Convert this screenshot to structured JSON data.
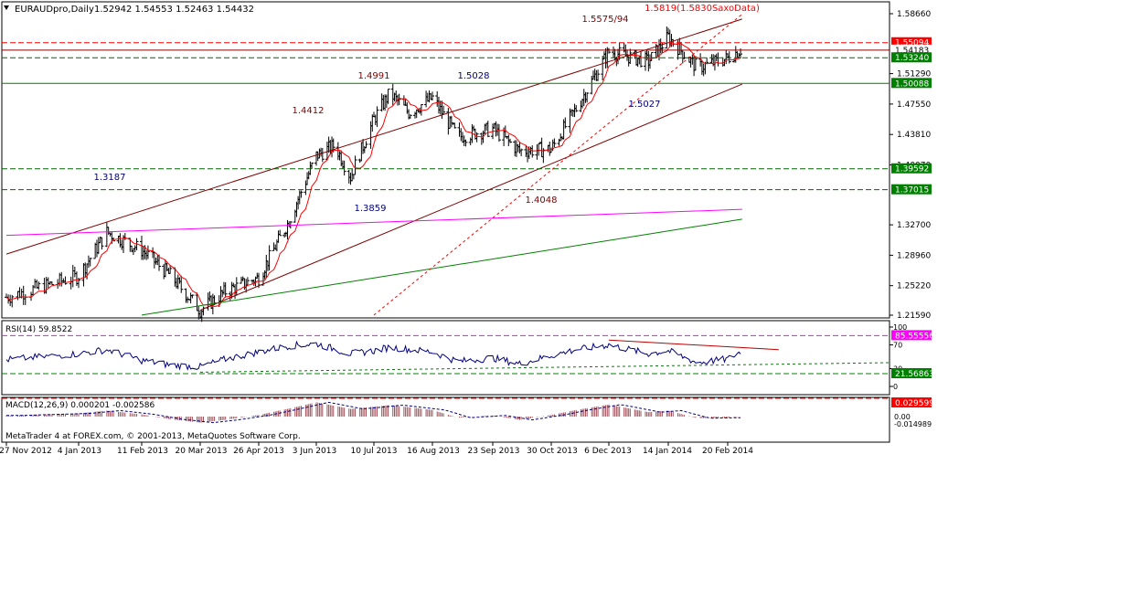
{
  "header": {
    "symbol": "EURAUDpro,Daily",
    "ohlc": "1.52942 1.54553 1.52463 1.54432"
  },
  "footer_watermark": "MetaTrader 4 at FOREX.com, © 2001-2013, MetaQuotes Software Corp.",
  "chart_data": [
    {
      "type": "candlestick",
      "panel": "price",
      "title": "EURAUDpro,Daily",
      "ylim": [
        1.2159,
        1.5866
      ],
      "y_ticks": [
        "1.58660",
        "1.51290",
        "1.47550",
        "1.43810",
        "1.40070",
        "1.32700",
        "1.28960",
        "1.25220",
        "1.21590"
      ],
      "x_ticks": [
        "27 Nov 2012",
        "4 Jan 2013",
        "11 Feb 2013",
        "20 Mar 2013",
        "26 Apr 2013",
        "3 Jun 2013",
        "10 Jul 2013",
        "16 Aug 2013",
        "23 Sep 2013",
        "30 Oct 2013",
        "6 Dec 2013",
        "14 Jan 2014",
        "20 Feb 2014"
      ],
      "close_path": [
        [
          "27 Nov 2012",
          1.238
        ],
        [
          "4 Jan 2013",
          1.264
        ],
        [
          "21 Jan 2013",
          1.318
        ],
        [
          "11 Feb 2013",
          1.296
        ],
        [
          "1 Mar 2013",
          1.265
        ],
        [
          "20 Mar 2013",
          1.222
        ],
        [
          "5 Apr 2013",
          1.245
        ],
        [
          "26 Apr 2013",
          1.262
        ],
        [
          "15 May 2013",
          1.328
        ],
        [
          "3 Jun 2013",
          1.412
        ],
        [
          "15 Jun 2013",
          1.425
        ],
        [
          "25 Jun 2013",
          1.386
        ],
        [
          "10 Jul 2013",
          1.457
        ],
        [
          "20 Jul 2013",
          1.489
        ],
        [
          "1 Aug 2013",
          1.465
        ],
        [
          "16 Aug 2013",
          1.483
        ],
        [
          "1 Sep 2013",
          1.435
        ],
        [
          "23 Sep 2013",
          1.445
        ],
        [
          "10 Oct 2013",
          1.418
        ],
        [
          "30 Oct 2013",
          1.42
        ],
        [
          "15 Nov 2013",
          1.47
        ],
        [
          "6 Dec 2013",
          1.54
        ],
        [
          "1 Jan 2014",
          1.528
        ],
        [
          "14 Jan 2014",
          1.558
        ],
        [
          "1 Feb 2014",
          1.52
        ],
        [
          "20 Feb 2014",
          1.532
        ],
        [
          "1 Mar 2014",
          1.544
        ]
      ],
      "moving_average_color": "#ff0000",
      "price_labels": [
        {
          "text": "1.3187",
          "color": "#000080"
        },
        {
          "text": "1.4412",
          "color": "#800000"
        },
        {
          "text": "1.4991",
          "color": "#800000"
        },
        {
          "text": "1.5028",
          "color": "#000080"
        },
        {
          "text": "1.3859",
          "color": "#000080"
        },
        {
          "text": "1.4048",
          "color": "#800000"
        },
        {
          "text": "1.5575/94",
          "color": "#800000"
        },
        {
          "text": "1.5819(1.5830SaxoData)",
          "color": "#ff0000"
        },
        {
          "text": "1.5027",
          "color": "#000080"
        }
      ],
      "horizontal_levels": [
        {
          "value": 1.55094,
          "label": "1.55094",
          "style": "dashed",
          "color": "#ff0000",
          "label_bg": "#ff0000",
          "label_fg": "#ffffff"
        },
        {
          "value": 1.54183,
          "label": "1.54183",
          "style": "solid",
          "color": "#8b0000",
          "label_bg": "#ffffff",
          "label_fg": "#000000"
        },
        {
          "value": 1.5324,
          "label": "1.53240",
          "style": "dashed",
          "color": "#006400",
          "label_bg": "#008000",
          "label_fg": "#ffffff"
        },
        {
          "value": 1.50088,
          "label": "1.50088",
          "style": "solid",
          "color": "#008000",
          "label_bg": "#008000",
          "label_fg": "#ffffff"
        },
        {
          "value": 1.39592,
          "label": "1.39592",
          "style": "dashed",
          "color": "#006400",
          "label_bg": "#008000",
          "label_fg": "#ffffff"
        },
        {
          "value": 1.37015,
          "label": "1.37015",
          "style": "dashed",
          "color": "#006400",
          "label_bg": "#008000",
          "label_fg": "#ffffff"
        }
      ],
      "trend_lines": [
        {
          "name": "channel-top",
          "color": "#800000",
          "from": [
            "27 Nov 2012",
            1.291
          ],
          "to": [
            "1 Mar 2014",
            1.58
          ]
        },
        {
          "name": "channel-bottom",
          "color": "#800000",
          "from": [
            "20 Mar 2013",
            1.222
          ],
          "to": [
            "1 Mar 2014",
            1.5
          ]
        },
        {
          "name": "long-green",
          "color": "#008000",
          "from": [
            "11 Feb 2013",
            1.216
          ],
          "to": [
            "1 Mar 2014",
            1.334
          ]
        },
        {
          "name": "magenta",
          "color": "#ff00ff",
          "from": [
            "27 Nov 2012",
            1.314
          ],
          "to": [
            "1 Mar 2014",
            1.346
          ]
        },
        {
          "name": "dotted-red",
          "color": "#ff0000",
          "from": [
            "10 Jul 2013",
            1.216
          ],
          "to": [
            "1 Mar 2014",
            1.586
          ]
        }
      ]
    },
    {
      "type": "line",
      "panel": "indicator",
      "name": "RSI(14) 59.8522",
      "header": "RSI(14) 59.8522",
      "ylim": [
        0,
        100
      ],
      "y_ticks": [
        "100",
        "70",
        "30",
        "0"
      ],
      "color": "#000080",
      "levels": [
        {
          "value": 85.55556,
          "label": "85.55556",
          "label_bg": "#ff00ff",
          "label_fg": "#ffffff"
        },
        {
          "value": 21.56863,
          "label": "21.56863",
          "label_bg": "#008000",
          "label_fg": "#ffffff"
        }
      ],
      "values_path": [
        [
          "27 Nov 2012",
          45
        ],
        [
          "4 Jan 2013",
          55
        ],
        [
          "21 Jan 2013",
          62
        ],
        [
          "11 Feb 2013",
          44
        ],
        [
          "1 Mar 2013",
          36
        ],
        [
          "20 Mar 2013",
          33
        ],
        [
          "5 Apr 2013",
          46
        ],
        [
          "26 Apr 2013",
          58
        ],
        [
          "15 May 2013",
          68
        ],
        [
          "3 Jun 2013",
          72
        ],
        [
          "25 Jun 2013",
          55
        ],
        [
          "10 Jul 2013",
          60
        ],
        [
          "20 Jul 2013",
          66
        ],
        [
          "16 Aug 2013",
          58
        ],
        [
          "1 Sep 2013",
          42
        ],
        [
          "23 Sep 2013",
          48
        ],
        [
          "10 Oct 2013",
          38
        ],
        [
          "30 Oct 2013",
          52
        ],
        [
          "15 Nov 2013",
          62
        ],
        [
          "6 Dec 2013",
          70
        ],
        [
          "1 Jan 2014",
          55
        ],
        [
          "14 Jan 2014",
          60
        ],
        [
          "1 Feb 2014",
          40
        ],
        [
          "20 Feb 2014",
          46
        ],
        [
          "1 Mar 2014",
          59.85
        ]
      ]
    },
    {
      "type": "bar",
      "panel": "indicator",
      "name": "MACD(12,26,9) 0.000201 -0.002586",
      "header": "MACD(12,26,9) 0.000201 -0.002586",
      "y_ticks": [
        "0.00",
        "-0.014989"
      ],
      "levels": [
        {
          "value": 0.029599,
          "label": "0.029599",
          "label_bg": "#ff0000",
          "label_fg": "#ffffff"
        }
      ],
      "histogram_color": "#a0525a",
      "signal_color": "#000080",
      "values_path": [
        [
          "27 Nov 2012",
          0.002
        ],
        [
          "4 Jan 2013",
          0.006
        ],
        [
          "21 Jan 2013",
          0.011
        ],
        [
          "11 Feb 2013",
          0.004
        ],
        [
          "1 Mar 2013",
          -0.005
        ],
        [
          "20 Mar 2013",
          -0.011
        ],
        [
          "5 Apr 2013",
          -0.006
        ],
        [
          "26 Apr 2013",
          0.003
        ],
        [
          "15 May 2013",
          0.014
        ],
        [
          "3 Jun 2013",
          0.026
        ],
        [
          "25 Jun 2013",
          0.014
        ],
        [
          "10 Jul 2013",
          0.018
        ],
        [
          "20 Jul 2013",
          0.021
        ],
        [
          "16 Aug 2013",
          0.012
        ],
        [
          "1 Sep 2013",
          -0.002
        ],
        [
          "23 Sep 2013",
          0.002
        ],
        [
          "10 Oct 2013",
          -0.006
        ],
        [
          "30 Oct 2013",
          0.003
        ],
        [
          "15 Nov 2013",
          0.012
        ],
        [
          "6 Dec 2013",
          0.022
        ],
        [
          "1 Jan 2014",
          0.008
        ],
        [
          "14 Jan 2014",
          0.011
        ],
        [
          "1 Feb 2014",
          -0.003
        ],
        [
          "20 Feb 2014",
          -0.002
        ],
        [
          "1 Mar 2014",
          0.0002
        ]
      ]
    }
  ]
}
